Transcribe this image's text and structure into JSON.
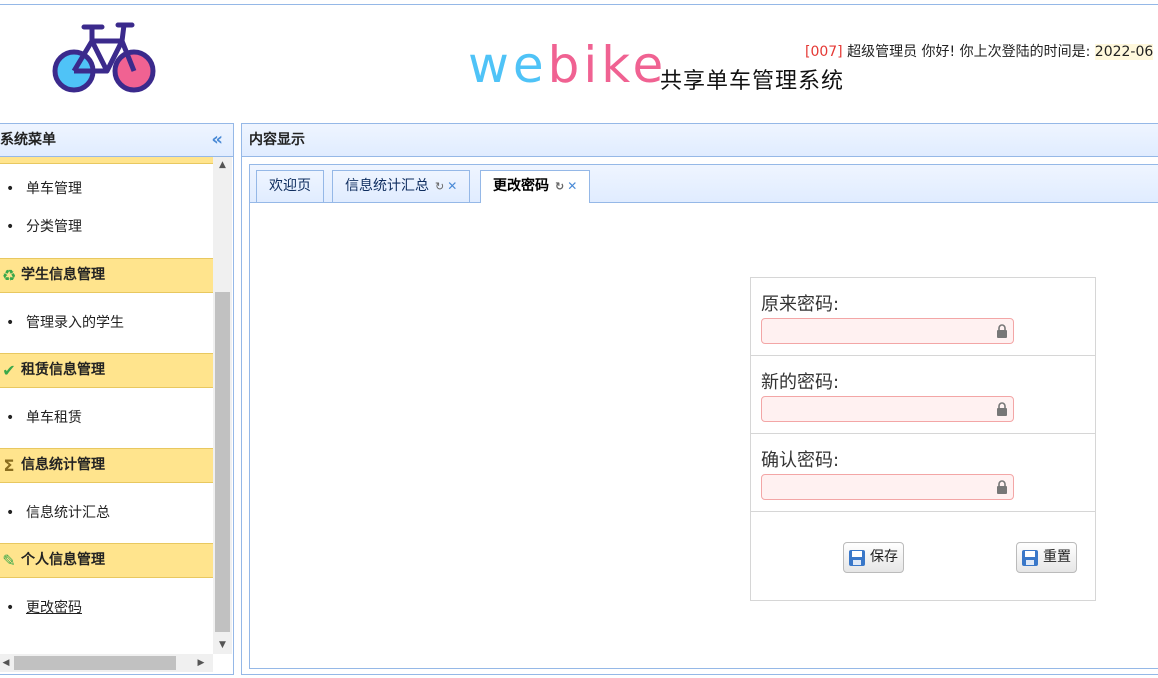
{
  "header": {
    "brand_we": "we",
    "brand_bike": "bike",
    "brand_subtitle": "共享单车管理系统",
    "welcome_id": "[007]",
    "welcome_text": " 超级管理员 你好! 你上次登陆的时间是: ",
    "welcome_time": "2022-06"
  },
  "west": {
    "title": "系统菜单",
    "top_items": [
      "单车管理",
      "分类管理"
    ],
    "groups": [
      {
        "title": "学生信息管理",
        "icon": "recycle-icon",
        "items": [
          "管理录入的学生"
        ]
      },
      {
        "title": "租赁信息管理",
        "icon": "check-icon",
        "items": [
          "单车租赁"
        ]
      },
      {
        "title": "信息统计管理",
        "icon": "sigma-icon",
        "items": [
          "信息统计汇总"
        ]
      },
      {
        "title": "个人信息管理",
        "icon": "pencil-icon",
        "items": [
          "更改密码"
        ]
      }
    ]
  },
  "center": {
    "title": "内容显示",
    "tabs": [
      {
        "label": "欢迎页"
      },
      {
        "label": "信息统计汇总"
      },
      {
        "label": "更改密码",
        "selected": true
      }
    ]
  },
  "form": {
    "old_label": "原来密码:",
    "new_label": "新的密码:",
    "confirm_label": "确认密码:",
    "save_label": "保存",
    "reset_label": "重置"
  },
  "colors": {
    "panel_border": "#95b8e7",
    "group_bg": "#ffe48d",
    "invalid_input_bg": "#fff1f1",
    "brand_blue": "#4fc3f7",
    "brand_pink": "#f06292"
  }
}
